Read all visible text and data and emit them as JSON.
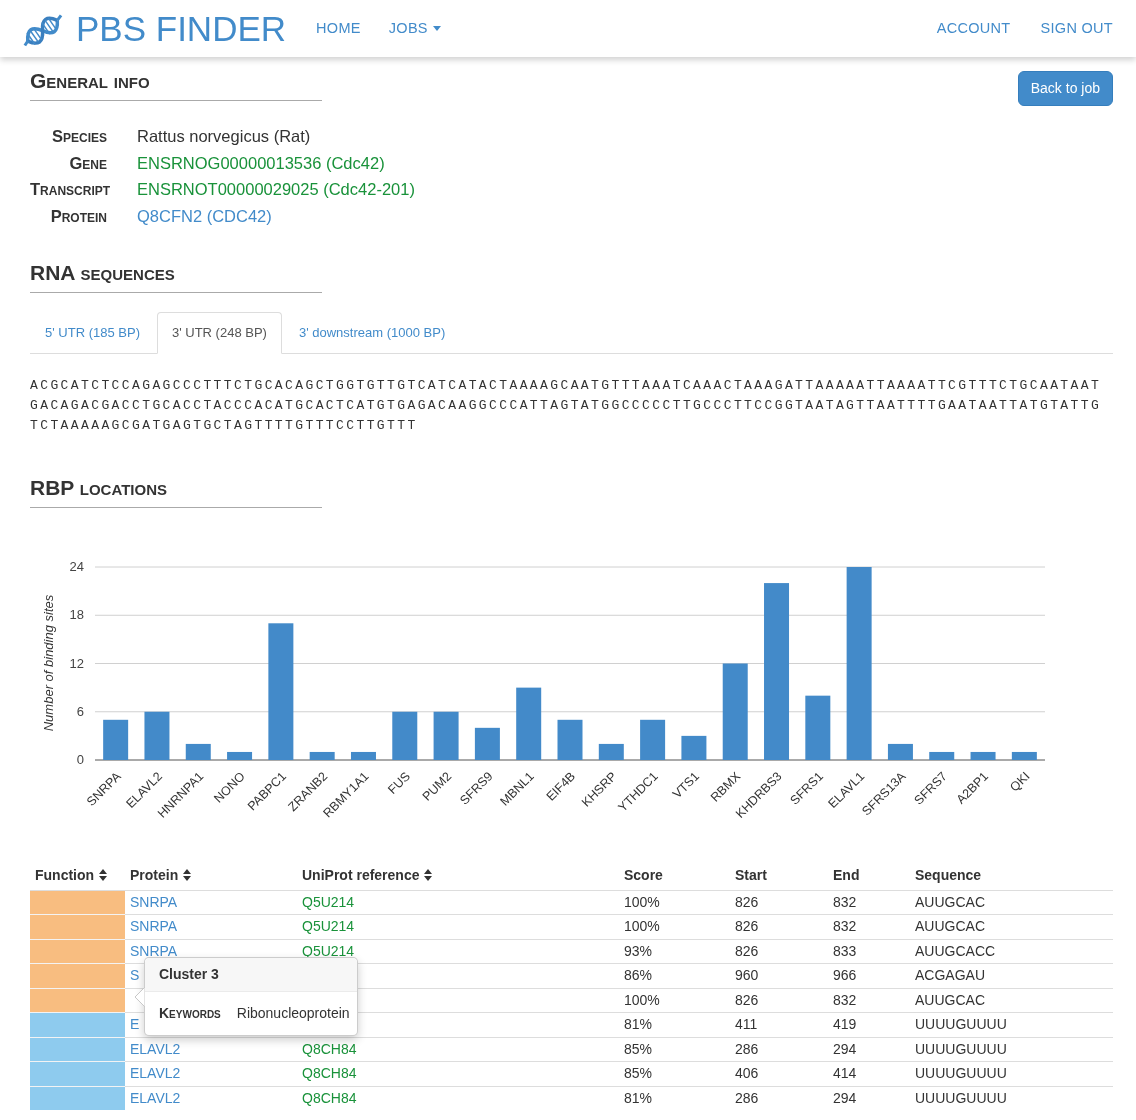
{
  "navbar": {
    "brand": "PBS FINDER",
    "links": [
      {
        "label": "HOME",
        "dropdown": false
      },
      {
        "label": "JOBS",
        "dropdown": true
      }
    ],
    "account_links": [
      {
        "label": "ACCOUNT",
        "dropdown": false
      },
      {
        "label": "SIGN OUT",
        "dropdown": false
      }
    ]
  },
  "back_button": "Back to job",
  "general_info": {
    "heading": "General info",
    "fields": [
      {
        "label": "Species",
        "value": "Rattus norvegicus (Rat)",
        "kind": "text"
      },
      {
        "label": "Gene",
        "value": "ENSRNOG00000013536 (Cdc42)",
        "kind": "ensembl"
      },
      {
        "label": "Transcript",
        "value": "ENSRNOT00000029025 (Cdc42-201)",
        "kind": "ensembl"
      },
      {
        "label": "Protein",
        "value": "Q8CFN2 (CDC42)",
        "kind": "uniprot"
      }
    ]
  },
  "rna_sequences": {
    "heading": "RNA sequences",
    "tabs": [
      {
        "label": "5' UTR (185 BP)",
        "selected": false
      },
      {
        "label": "3' UTR (248 BP)",
        "selected": true
      },
      {
        "label": "3' downstream (1000 BP)",
        "selected": false
      }
    ],
    "sequence": "ACGCATCTCCAGAGCCCTTTCTGCACAGCTGGTGTTGTCATCATACTAAAAGCAATGTTTAAATCAAACTAAAGATTAAAAATTAAAATTCGTTTCTGCAATAATGACAGACGACCTGCACCTACCCACATGCACTCATGTGAGACAAGGCCCATTAGTATGGCCCCCTTGCCCTTCCGGTAATAGTTAATTTTGAATAATTATGTATTGTCTAAAAAGCGATGAGTGCTAGTTTTGTTTCCTTGTTT"
  },
  "rbp_locations": {
    "heading": "RBP locations",
    "chart_data": {
      "type": "bar",
      "ylabel": "Number of binding sites",
      "categories": [
        "SNRPA",
        "ELAVL2",
        "HNRNPA1",
        "NONO",
        "PABPC1",
        "ZRANB2",
        "RBMY1A1",
        "FUS",
        "PUM2",
        "SFRS9",
        "MBNL1",
        "EIF4B",
        "KHSRP",
        "YTHDC1",
        "VTS1",
        "RBMX",
        "KHDRBS3",
        "SFRS1",
        "ELAVL1",
        "SFRS13A",
        "SFRS7",
        "A2BP1",
        "QKI"
      ],
      "series": [
        {
          "color": "#438ac9",
          "values": [
            5,
            6,
            2,
            1,
            17,
            1,
            1,
            6,
            6,
            4,
            9,
            5,
            2,
            5,
            3,
            12,
            22,
            8,
            24,
            2,
            1,
            1,
            1
          ]
        }
      ],
      "ylim": [
        0,
        24
      ],
      "yticks": [
        0,
        6,
        12,
        18,
        24
      ],
      "grid": true
    }
  },
  "table": {
    "columns": [
      {
        "label": "Function",
        "sortable": true
      },
      {
        "label": "Protein",
        "sortable": true
      },
      {
        "label": "UniProt reference",
        "sortable": true
      },
      {
        "label": "Score",
        "sortable": false
      },
      {
        "label": "Start",
        "sortable": false
      },
      {
        "label": "End",
        "sortable": false
      },
      {
        "label": "Sequence",
        "sortable": false
      }
    ],
    "rows": [
      {
        "color": "#f8bd80",
        "protein": "SNRPA",
        "uniprot": "Q5U214",
        "score": "100%",
        "start": "826",
        "end": "832",
        "sequence": "AUUGCAC"
      },
      {
        "color": "#f8bd80",
        "protein": "SNRPA",
        "uniprot": "Q5U214",
        "score": "100%",
        "start": "826",
        "end": "832",
        "sequence": "AUUGCAC"
      },
      {
        "color": "#f8bd80",
        "protein": "SNRPA",
        "uniprot": "Q5U214",
        "score": "93%",
        "start": "826",
        "end": "833",
        "sequence": "AUUGCACC"
      },
      {
        "color": "#f8bd80",
        "protein": "S",
        "score": "86%",
        "start": "960",
        "end": "966",
        "sequence": "ACGAGAU"
      },
      {
        "color": "#f8bd80",
        "score": "100%",
        "start": "826",
        "end": "832",
        "sequence": "AUUGCAC"
      },
      {
        "color": "#8ecbee",
        "protein": "E",
        "score": "81%",
        "start": "411",
        "end": "419",
        "sequence": "UUUUGUUUU"
      },
      {
        "color": "#8ecbee",
        "protein": "ELAVL2",
        "uniprot": "Q8CH84",
        "score": "85%",
        "start": "286",
        "end": "294",
        "sequence": "UUUUGUUUU"
      },
      {
        "color": "#8ecbee",
        "protein": "ELAVL2",
        "uniprot": "Q8CH84",
        "score": "85%",
        "start": "406",
        "end": "414",
        "sequence": "UUUUGUUUU"
      },
      {
        "color": "#8ecbee",
        "protein": "ELAVL2",
        "uniprot": "Q8CH84",
        "score": "81%",
        "start": "286",
        "end": "294",
        "sequence": "UUUUGUUUU"
      }
    ]
  },
  "popover": {
    "title": "Cluster 3",
    "label": "Keywords",
    "value": "Ribonucleoprotein"
  }
}
